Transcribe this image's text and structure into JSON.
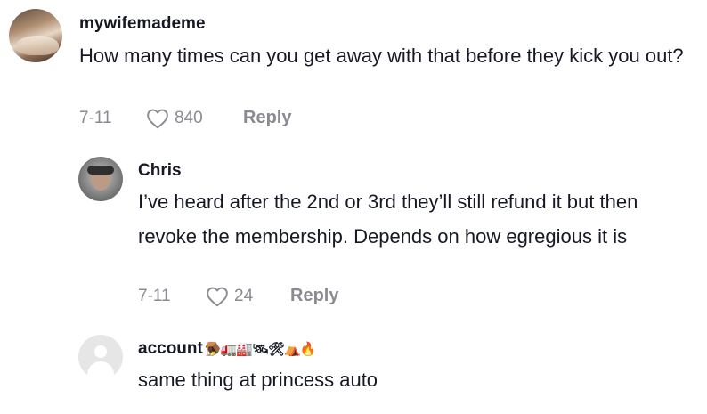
{
  "comments": [
    {
      "username": "mywifemademe",
      "text": "How many times can you get away with that before they kick you out?",
      "date": "7-11",
      "likes": "840",
      "reply_label": "Reply"
    },
    {
      "username": "Chris",
      "text": "I’ve heard after the 2nd or 3rd they’ll still refund it but then revoke the membership. Depends on how egregious it is",
      "date": "7-11",
      "likes": "24",
      "reply_label": "Reply"
    },
    {
      "username": "account",
      "username_emoji": "🪤🚛🏭🛰🛠⛺🔥",
      "text": "same thing at princess auto"
    }
  ],
  "icons": {
    "like": "heart-outline-icon",
    "default_avatar": "default-avatar-icon"
  },
  "colors": {
    "text": "#161823",
    "secondary": "#8a8b91",
    "background": "#ffffff"
  }
}
